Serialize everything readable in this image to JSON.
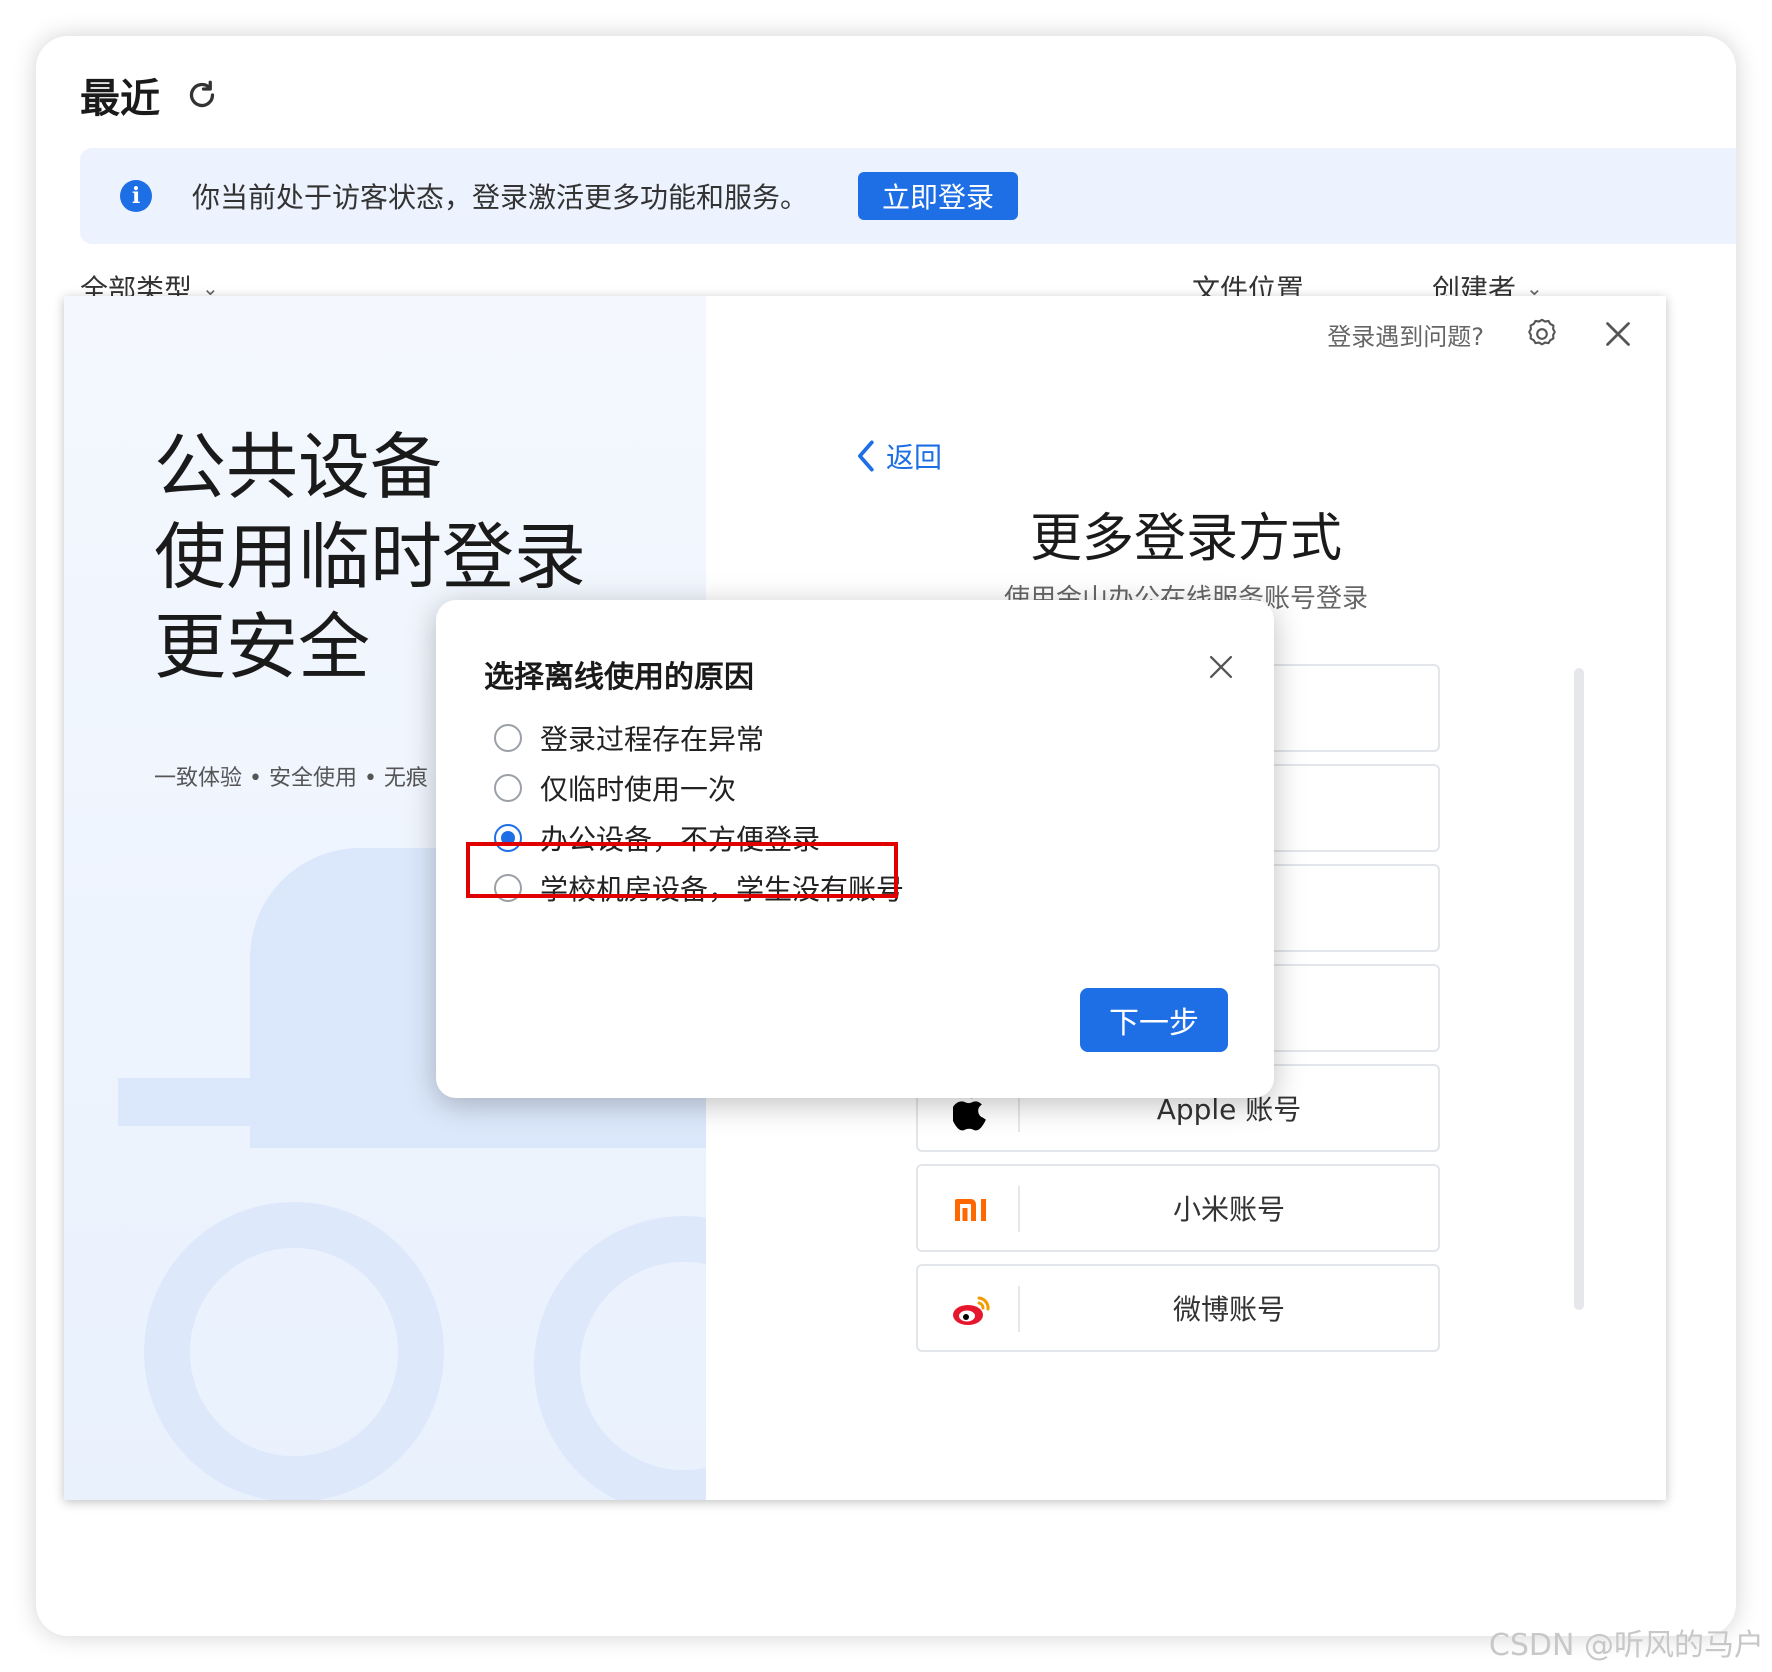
{
  "header": {
    "title": "最近",
    "refresh_icon": "refresh-icon"
  },
  "banner": {
    "icon": "info-icon",
    "icon_text": "i",
    "text": "你当前处于访客状态，登录激活更多功能和服务。",
    "button": "立即登录"
  },
  "filters": {
    "type": "全部类型",
    "location": "文件位置",
    "creator": "创建者"
  },
  "promo": {
    "lines": [
      "公共设备",
      "使用临时登录",
      "更安全"
    ],
    "features": "一致体验 • 安全使用 • 无痕"
  },
  "login": {
    "help": "登录遇到问题?",
    "settings_icon": "gear-icon",
    "close_icon": "close-icon",
    "back": "返回",
    "title": "更多登录方式",
    "subtitle": "使用金山办公在线服务账号登录",
    "methods": [
      {
        "label": "",
        "icon": ""
      },
      {
        "label": "",
        "icon": ""
      },
      {
        "label": "",
        "icon": ""
      },
      {
        "label": "",
        "icon": ""
      },
      {
        "label": "Apple 账号",
        "icon": "apple-icon"
      },
      {
        "label": "小米账号",
        "icon": "xiaomi-icon"
      },
      {
        "label": "微博账号",
        "icon": "weibo-icon"
      }
    ]
  },
  "modal": {
    "title": "选择离线使用的原因",
    "options": [
      "登录过程存在异常",
      "仅临时使用一次",
      "办公设备，不方便登录",
      "学校机房设备，学生没有账号"
    ],
    "selected_index": 2,
    "next": "下一步"
  },
  "watermark": "CSDN @听风的马户",
  "colors": {
    "accent": "#1e6fe6",
    "highlight": "#e00000",
    "xiaomi": "#ff6700",
    "weibo": "#e6162d"
  }
}
